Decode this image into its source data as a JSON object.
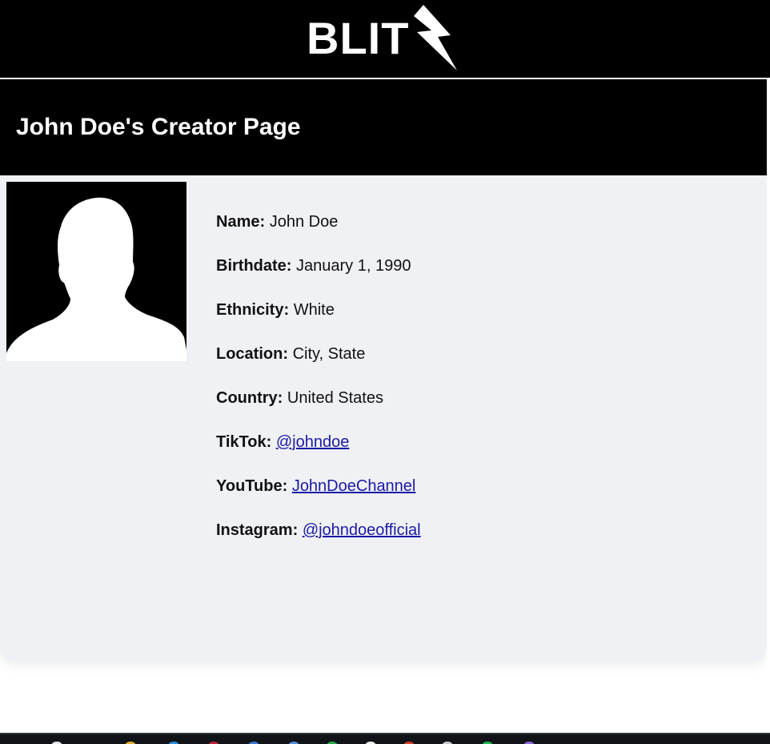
{
  "brand": {
    "logo_text": "BLIT"
  },
  "header": {
    "title": "John Doe's Creator Page"
  },
  "profile": {
    "avatar_icon": "person-silhouette-icon",
    "fields": [
      {
        "label": "Name:",
        "value": "John Doe",
        "link": false
      },
      {
        "label": "Birthdate:",
        "value": "January 1, 1990",
        "link": false
      },
      {
        "label": "Ethnicity:",
        "value": "White",
        "link": false
      },
      {
        "label": "Location:",
        "value": "City, State",
        "link": false
      },
      {
        "label": "Country:",
        "value": "United States",
        "link": false
      },
      {
        "label": "TikTok:",
        "value": "@johndoe",
        "link": true
      },
      {
        "label": "YouTube:",
        "value": "JohnDoeChannel",
        "link": true
      },
      {
        "label": "Instagram:",
        "value": "@johndoeofficial",
        "link": true
      }
    ]
  },
  "colors": {
    "header_bg": "#000000",
    "card_bg": "#f0f1f4",
    "link": "#1a1aa6"
  }
}
